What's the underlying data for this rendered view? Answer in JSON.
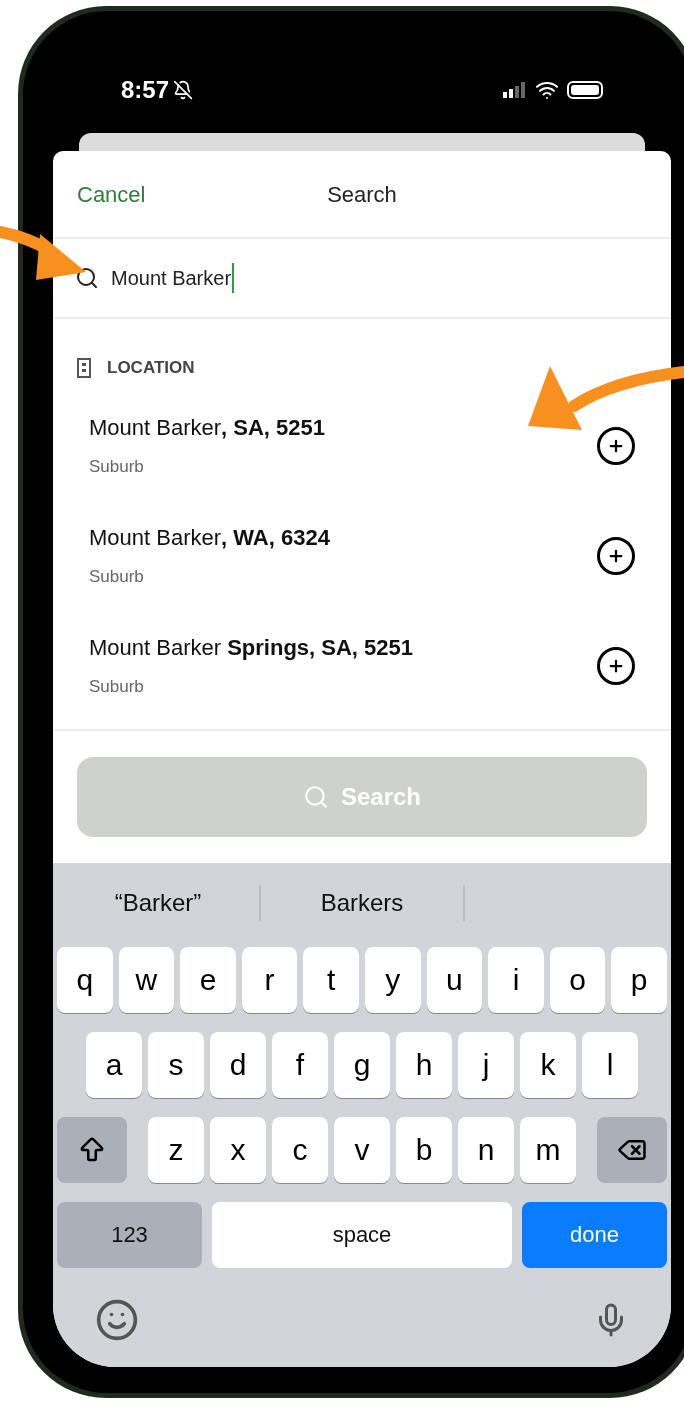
{
  "status_bar": {
    "time": "8:57"
  },
  "header": {
    "cancel": "Cancel",
    "title": "Search"
  },
  "search_field": {
    "value": "Mount Barker"
  },
  "section": {
    "label": "LOCATION"
  },
  "results": [
    {
      "title": "Mount Barker**, SA, 5251**",
      "subtitle": "Suburb"
    },
    {
      "title": "Mount Barker**, WA, 6324**",
      "subtitle": "Suburb"
    },
    {
      "title": "Mount Barker **Springs, SA, 5251**",
      "subtitle": "Suburb"
    }
  ],
  "search_button": {
    "label": "Search",
    "disabled": true
  },
  "keyboard": {
    "suggestions": [
      "“Barker”",
      "Barkers"
    ],
    "rows": [
      [
        "q",
        "w",
        "e",
        "r",
        "t",
        "y",
        "u",
        "i",
        "o",
        "p"
      ],
      [
        "a",
        "s",
        "d",
        "f",
        "g",
        "h",
        "j",
        "k",
        "l"
      ],
      [
        "z",
        "x",
        "c",
        "v",
        "b",
        "n",
        "m"
      ]
    ],
    "numbers": "123",
    "space": "space",
    "done": "done"
  }
}
